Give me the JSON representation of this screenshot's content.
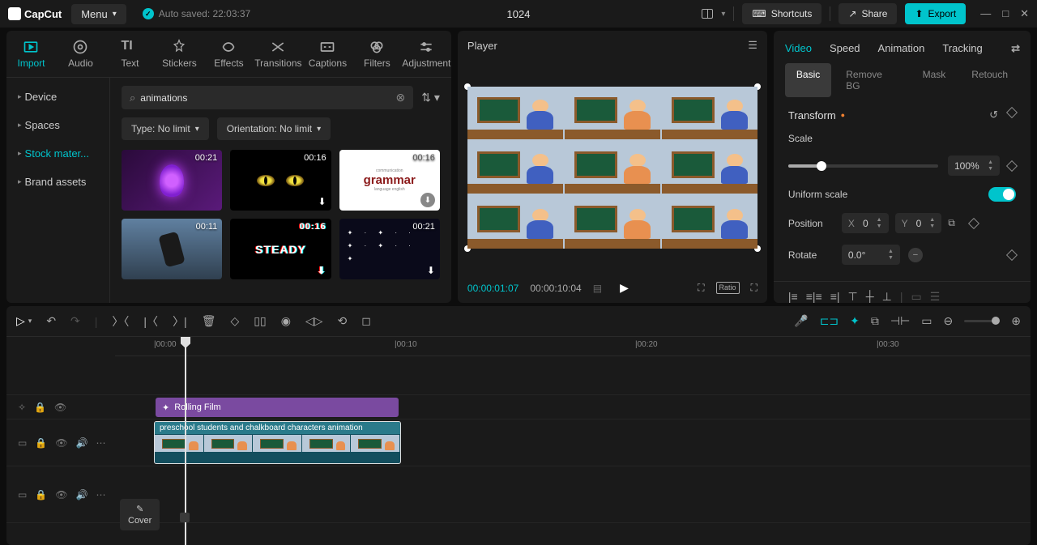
{
  "titlebar": {
    "app": "CapCut",
    "menu": "Menu",
    "autosave": "Auto saved: 22:03:37",
    "project": "1024",
    "shortcuts": "Shortcuts",
    "share": "Share",
    "export": "Export"
  },
  "toolTabs": [
    "Import",
    "Audio",
    "Text",
    "Stickers",
    "Effects",
    "Transitions",
    "Captions",
    "Filters",
    "Adjustment"
  ],
  "sidebar": [
    "Device",
    "Spaces",
    "Stock mater...",
    "Brand assets"
  ],
  "search": {
    "value": "animations",
    "typeFilter": "Type: No limit",
    "orientFilter": "Orientation: No limit"
  },
  "cards": [
    {
      "dur": "00:21"
    },
    {
      "dur": "00:16"
    },
    {
      "dur": "00:16"
    },
    {
      "dur": "00:11"
    },
    {
      "dur": "00:16"
    },
    {
      "dur": "00:21"
    }
  ],
  "grammar": {
    "top": "communication",
    "mid": "grammar",
    "bot": "language english"
  },
  "steady": "STEADY",
  "player": {
    "title": "Player",
    "current": "00:00:01:07",
    "duration": "00:00:10:04",
    "ratio": "Ratio"
  },
  "inspector": {
    "tabs": [
      "Video",
      "Speed",
      "Animation",
      "Tracking"
    ],
    "subTabs": [
      "Basic",
      "Remove BG",
      "Mask",
      "Retouch"
    ],
    "transform": "Transform",
    "scale": "Scale",
    "scaleVal": "100%",
    "uniform": "Uniform scale",
    "position": "Position",
    "posX": "0",
    "posY": "0",
    "rotate": "Rotate",
    "rotateVal": "0.0°"
  },
  "timeline": {
    "marks": [
      "|00:00",
      "|00:10",
      "|00:20",
      "|00:30"
    ],
    "effectName": "Rolling Film",
    "clipName": "preschool students and chalkboard characters animation",
    "cover": "Cover"
  }
}
